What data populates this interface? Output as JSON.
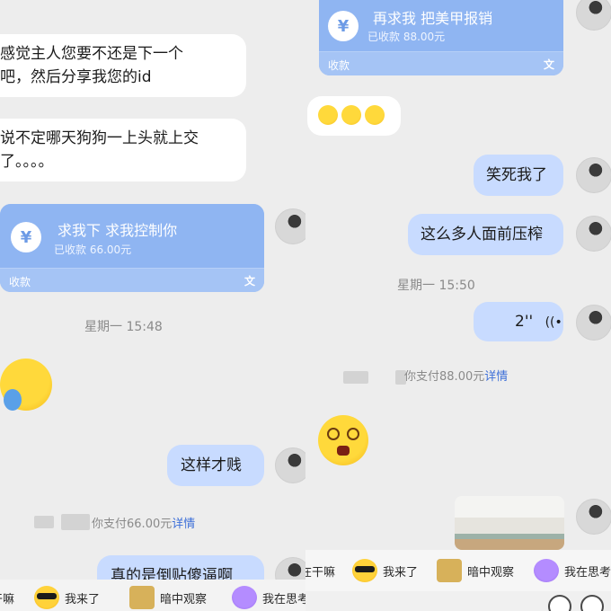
{
  "left": {
    "msg1": {
      "line1": "感觉主人您要不还是下一个",
      "line2": "吧，然后分享我您的id"
    },
    "msg2": {
      "line1": "说不定哪天狗狗一上头就上交",
      "line2": "了。。。。"
    },
    "transfer": {
      "title": "求我下 求我控制你",
      "status": "已收款 66.00元",
      "footer": "收款",
      "coin": "¥",
      "icon": "translate-icon"
    },
    "time": "星期一 15:48",
    "msg3": "这样才贱",
    "system": {
      "prefix": "你支付",
      "amount": "66.00元",
      "link": "详情"
    },
    "msg4": "真的是倒贴傻逼啊",
    "tray": [
      {
        "label": "干嘛",
        "icon": "emoji-icon"
      },
      {
        "label": "我来了",
        "icon": "sunglasses-emoji-icon"
      },
      {
        "label": "暗中观察",
        "icon": "peeking-emoji-icon"
      },
      {
        "label": "我在思考",
        "icon": "thinking-emoji-icon"
      }
    ]
  },
  "right": {
    "transfer": {
      "title": "再求我 把美甲报销",
      "status": "已收款 88.00元",
      "footer": "收款",
      "coin": "¥",
      "icon": "translate-icon"
    },
    "msg1": "笑死我了",
    "msg2": "这么多人面前压榨",
    "time": "星期一 15:50",
    "voice": {
      "duration": "2''"
    },
    "system": {
      "prefix": "你支付",
      "amount": "88.00元",
      "link": "详情"
    },
    "tray": [
      {
        "label": "在干嘛",
        "icon": "emoji-icon"
      },
      {
        "label": "我来了",
        "icon": "sunglasses-emoji-icon"
      },
      {
        "label": "暗中观察",
        "icon": "peeking-emoji-icon"
      },
      {
        "label": "我在思考",
        "icon": "thinking-emoji-icon"
      }
    ]
  },
  "colors": {
    "bubble_blue": "#c8dbff",
    "transfer_blue": "#8fb5f2",
    "link_blue": "#3d6fd8",
    "background": "#ededed"
  }
}
